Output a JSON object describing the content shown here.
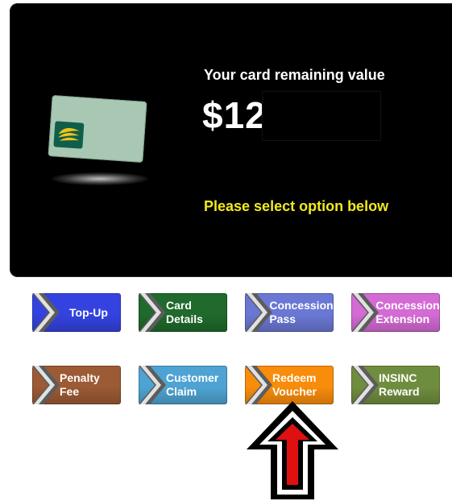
{
  "panel": {
    "title": "Your card remaining value",
    "value": "$12",
    "prompt": "Please select option below"
  },
  "colors": {
    "panel_bg": "#000000",
    "prompt": "#f2ea1c",
    "chevron": "#5c5c5c"
  },
  "buttons": [
    {
      "label": "Top-Up",
      "color": "#3443e0",
      "icon": "chevron-right-icon"
    },
    {
      "label": "Card Details",
      "color": "#1f6a2c",
      "icon": "chevron-right-icon"
    },
    {
      "label": "Concession Pass",
      "color": "#6a78d4",
      "icon": "chevron-right-icon"
    },
    {
      "label": "Concession Extension",
      "color": "#d46ad4",
      "icon": "chevron-right-icon"
    },
    {
      "label": "Penalty Fee",
      "color": "#9c5a35",
      "icon": "chevron-right-icon"
    },
    {
      "label": "Customer Claim",
      "color": "#4ea3d3",
      "icon": "chevron-right-icon"
    },
    {
      "label": "Redeem Voucher",
      "color": "#f88c0b",
      "icon": "chevron-right-icon"
    },
    {
      "label": "INSINC Reward",
      "color": "#6f8d3e",
      "icon": "chevron-right-icon"
    }
  ],
  "indicator": {
    "icon": "up-arrow-icon",
    "color": "#e01010"
  }
}
